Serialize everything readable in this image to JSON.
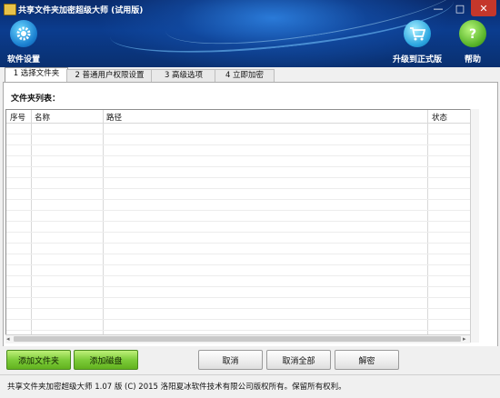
{
  "window": {
    "title": "共享文件夹加密超级大师 (试用版)",
    "controls": {
      "minimize": "—",
      "maximize": "□",
      "close": "✕"
    }
  },
  "toolbar": {
    "settings_label": "软件设置",
    "upgrade_label": "升级到正式版",
    "help_label": "帮助"
  },
  "tabs": [
    {
      "label": "1 选择文件夹",
      "active": true
    },
    {
      "label": "2 普通用户权限设置",
      "active": false
    },
    {
      "label": "3 高级选项",
      "active": false
    },
    {
      "label": "4 立即加密",
      "active": false
    }
  ],
  "folder_list": {
    "label": "文件夹列表：",
    "columns": [
      "序号",
      "名称",
      "路径",
      "状态"
    ],
    "rows": []
  },
  "buttons": {
    "add_folder": "添加文件夹",
    "add_disk": "添加磁盘",
    "cancel": "取消",
    "cancel_all": "取消全部",
    "decrypt": "解密"
  },
  "status": {
    "text": "共享文件夹加密超级大师 1.07 版 (C) 2015 洛阳夏冰软件技术有限公司版权所有。保留所有权利。"
  },
  "colors": {
    "header_bg": "#0b3c8e",
    "green_button": "#7dcc3a",
    "close_button": "#c4372b"
  }
}
